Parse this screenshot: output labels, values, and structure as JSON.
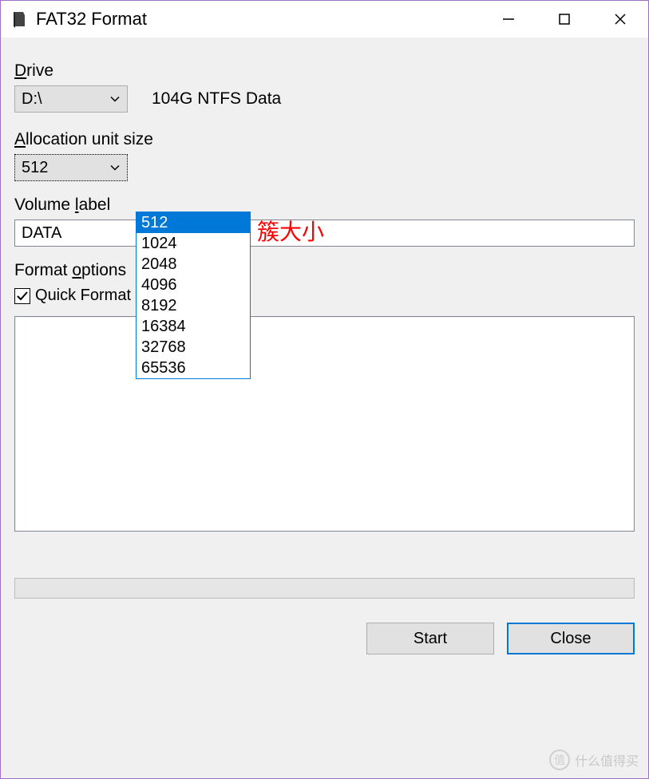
{
  "titlebar": {
    "title": "FAT32 Format"
  },
  "labels": {
    "drive": "Drive",
    "drive_ul": "D",
    "alloc": "Allocation unit size",
    "alloc_ul": "A",
    "volume": "Volume label",
    "volume_ul": "l",
    "format_opts": "Format options",
    "format_opts_ul": "o",
    "quick": "Quick Format",
    "quick_ul": "Q"
  },
  "drive": {
    "selected": "D:\\",
    "info": "104G NTFS Data"
  },
  "alloc": {
    "selected": "512",
    "options": [
      "512",
      "1024",
      "2048",
      "4096",
      "8192",
      "16384",
      "32768",
      "65536"
    ]
  },
  "volume": {
    "value": "DATA"
  },
  "quick_format": {
    "checked": true
  },
  "buttons": {
    "start": "Start",
    "close": "Close"
  },
  "annotation": "簇大小",
  "watermark": {
    "glyph": "值",
    "text": "什么值得买"
  }
}
